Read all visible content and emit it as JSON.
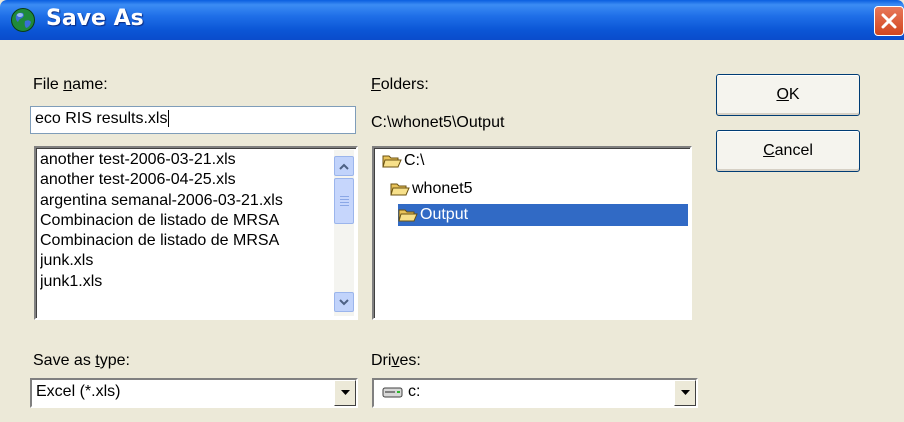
{
  "window": {
    "title": "Save As",
    "icons": {
      "app": "globe-icon",
      "close": "close-icon"
    }
  },
  "file_name": {
    "label_pre": "File ",
    "label_key": "n",
    "label_post": "ame:",
    "value": "eco RIS results.xls"
  },
  "files": [
    "another test-2006-03-21.xls",
    "another test-2006-04-25.xls",
    "argentina semanal-2006-03-21.xls",
    "Combinacion de listado de MRSA",
    "Combinacion de listado de MRSA",
    "junk.xls",
    "junk1.xls"
  ],
  "folders": {
    "label_key": "F",
    "label_post": "olders:",
    "current_path": "C:\\whonet5\\Output",
    "items": [
      "C:\\",
      "whonet5",
      "Output"
    ],
    "selected": "Output"
  },
  "buttons": {
    "ok_key": "O",
    "ok_post": "K",
    "cancel_key": "C",
    "cancel_post": "ancel"
  },
  "save_as_type": {
    "label_pre": "Save as ",
    "label_key": "t",
    "label_post": "ype:",
    "value": "Excel (*.xls)"
  },
  "drives": {
    "label_pre": "Dri",
    "label_key": "v",
    "label_post": "es:",
    "value": "c:",
    "icon": "drive-icon"
  },
  "colors": {
    "titlebar": "#0a5ee0",
    "dialog_bg": "#ece9d8",
    "selection": "#316ac5",
    "close": "#d2461f"
  }
}
